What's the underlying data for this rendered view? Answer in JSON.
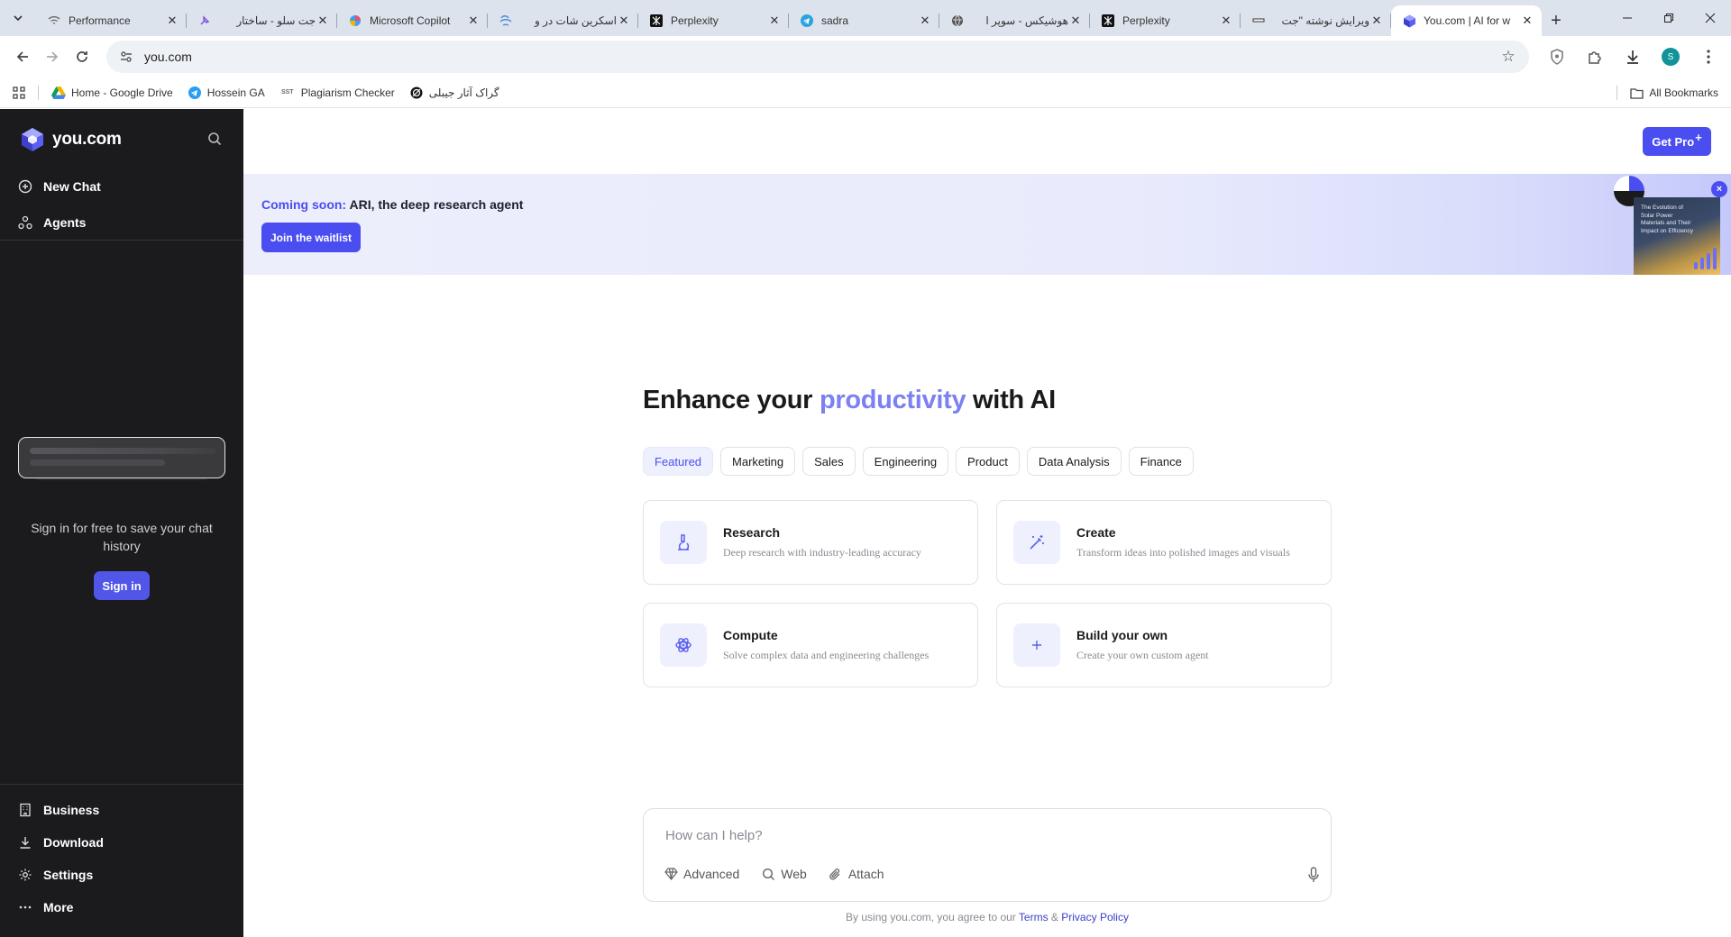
{
  "browser": {
    "tabs": [
      {
        "title": "Performance",
        "icon": "wifi-icon",
        "active": false
      },
      {
        "title": "جت سلو - ساختار",
        "icon": "pin-icon",
        "active": false
      },
      {
        "title": "Microsoft Copilot",
        "icon": "copilot-icon",
        "active": false
      },
      {
        "title": "اسکرین شات در و",
        "icon": "cloud-icon",
        "active": false
      },
      {
        "title": "Perplexity",
        "icon": "perplexity-icon",
        "active": false
      },
      {
        "title": "sadra",
        "icon": "telegram-icon",
        "active": false
      },
      {
        "title": "هوشیکس - سوپر ا",
        "icon": "globe-icon",
        "active": false
      },
      {
        "title": "Perplexity",
        "icon": "perplexity-icon",
        "active": false
      },
      {
        "title": "ویرایش نوشته \"جت",
        "icon": "doc-icon",
        "active": false
      },
      {
        "title": "You.com | AI for w",
        "icon": "youcom-icon",
        "active": true
      }
    ],
    "url": "you.com",
    "profile_initial": "S",
    "bookmarks": [
      {
        "label": "Home - Google Drive",
        "icon": "google-drive-icon"
      },
      {
        "label": "Hossein GA",
        "icon": "analytics-icon"
      },
      {
        "label": "Plagiarism Checker",
        "icon": "sst-icon"
      },
      {
        "label": "گراک آثار جیبلی",
        "icon": "grok-icon"
      }
    ],
    "sst_badge": "SST",
    "all_bookmarks": "All Bookmarks"
  },
  "sidebar": {
    "brand": "you.com",
    "nav": [
      {
        "label": "New Chat",
        "icon": "plus-circle-icon"
      },
      {
        "label": "Agents",
        "icon": "agents-icon"
      }
    ],
    "signin_prompt": "Sign in for free to save your chat history",
    "signin_button": "Sign in",
    "bottom": [
      {
        "label": "Business",
        "icon": "building-icon"
      },
      {
        "label": "Download",
        "icon": "download-icon"
      },
      {
        "label": "Settings",
        "icon": "gear-icon"
      },
      {
        "label": "More",
        "icon": "more-dots-icon"
      }
    ]
  },
  "main": {
    "get_pro": "Get Pro",
    "get_pro_sup": "+",
    "banner": {
      "soon": "Coming soon:",
      "text": " ARI, the deep research agent",
      "button": "Join the waitlist",
      "promo_title": "The Evolution of Solar Power Materials and Their Impact on Efficiency",
      "close": "×"
    },
    "hero": {
      "pre": "Enhance your ",
      "highlight": "productivity",
      "post": " with AI"
    },
    "chips": [
      "Featured",
      "Marketing",
      "Sales",
      "Engineering",
      "Product",
      "Data Analysis",
      "Finance"
    ],
    "active_chip": "Featured",
    "cards": [
      {
        "title": "Research",
        "desc": "Deep research with industry-leading accuracy",
        "icon": "microscope-icon"
      },
      {
        "title": "Create",
        "desc": "Transform ideas into polished images and visuals",
        "icon": "magic-wand-icon"
      },
      {
        "title": "Compute",
        "desc": "Solve complex data and engineering challenges",
        "icon": "atom-icon"
      },
      {
        "title": "Build your own",
        "desc": "Create your own custom agent",
        "icon": "plus-icon"
      }
    ],
    "composer": {
      "placeholder": "How can I help?",
      "options": [
        {
          "label": "Advanced",
          "icon": "diamond-icon"
        },
        {
          "label": "Web",
          "icon": "search-icon"
        },
        {
          "label": "Attach",
          "icon": "paperclip-icon"
        }
      ]
    },
    "legal": {
      "pre": "By using you.com, you agree to our ",
      "terms": "Terms",
      "amp": " & ",
      "privacy": "Privacy Policy"
    }
  },
  "colors": {
    "accent": "#4a4ef0",
    "sidebar_bg": "#1b1b1d",
    "highlight": "#7b80f2"
  }
}
